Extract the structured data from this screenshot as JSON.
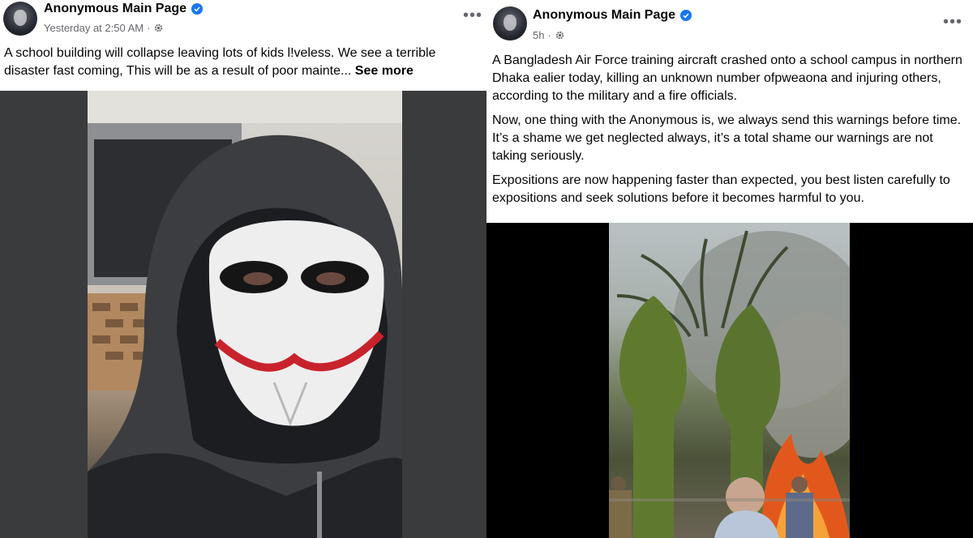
{
  "left_post": {
    "page_name": "Anonymous Main Page",
    "timestamp": "Yesterday at 2:50 AM",
    "separator": "·",
    "text": "A school building will collapse leaving lots of kids l!veless. We see a terrible disaster fast coming, This will be as a result of poor mainte...",
    "see_more": "See more",
    "media": "image: person in hoodie wearing Guy Fawkes style mask"
  },
  "right_post": {
    "page_name": "Anonymous Main Page",
    "timestamp": "5h",
    "separator": "·",
    "paragraphs": [
      "A Bangladesh Air Force training aircraft crashed onto a school campus in northern Dhaka ealier today, killing an unknown number ofpweaona and injuring others, according to the military and a fire officials.",
      "Now, one thing with the Anonymous is, we always send this warnings before time. It’s a shame we get neglected always, it’s a total shame our warnings are not taking seriously.",
      "Expositions are now happening faster than expected, you best listen carefully to expositions and seek solutions before it becomes harmful to you."
    ],
    "media": "video still: fire and smoke behind trees with people watching"
  },
  "colors": {
    "verified_blue": "#1877f2",
    "meta_gray": "#65676b",
    "text": "#050505"
  },
  "icons": [
    "verified-badge-icon",
    "privacy-gear-icon",
    "more-options-icon"
  ]
}
